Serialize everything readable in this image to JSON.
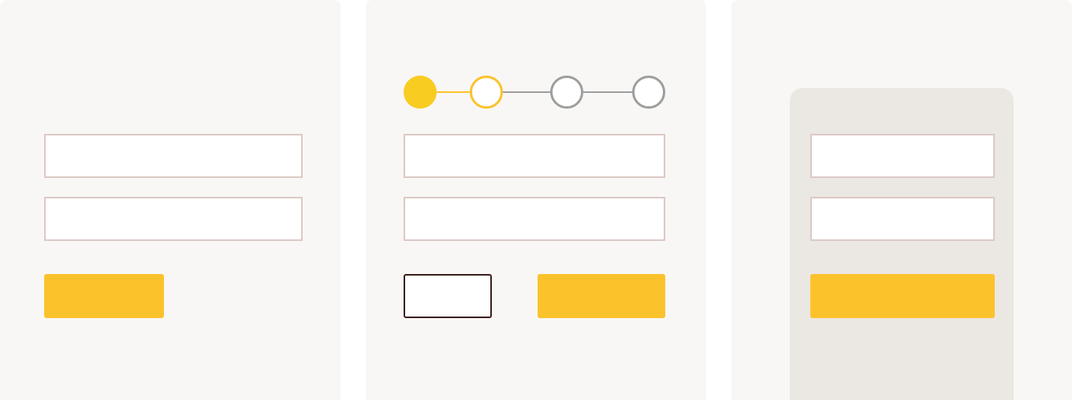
{
  "colors": {
    "panel_background": "#f8f7f5",
    "card_background": "#ebe7e3",
    "field_border": "#dcc9c5",
    "primary_button": "#fcc22c",
    "secondary_button_border": "#3a1f1b",
    "step_complete": "#f9cc22",
    "step_current": "#fcc22c",
    "step_upcoming": "#9e9e9e"
  },
  "panel_1": {
    "fields": [
      {
        "value": "",
        "placeholder": ""
      },
      {
        "value": "",
        "placeholder": ""
      }
    ],
    "submit_label": ""
  },
  "panel_2": {
    "stepper": {
      "total_steps": 4,
      "current_step": 2,
      "steps": [
        {
          "state": "complete"
        },
        {
          "state": "current"
        },
        {
          "state": "upcoming"
        },
        {
          "state": "upcoming"
        }
      ]
    },
    "fields": [
      {
        "value": "",
        "placeholder": ""
      },
      {
        "value": "",
        "placeholder": ""
      }
    ],
    "back_label": "",
    "next_label": ""
  },
  "panel_3": {
    "fields": [
      {
        "value": "",
        "placeholder": ""
      },
      {
        "value": "",
        "placeholder": ""
      }
    ],
    "submit_label": ""
  }
}
